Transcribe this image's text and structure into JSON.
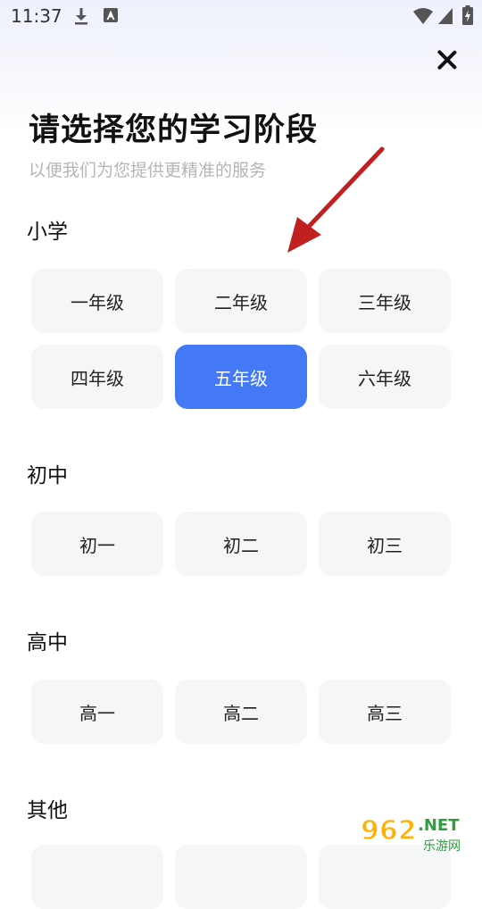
{
  "status_bar": {
    "time": "11:37"
  },
  "header": {
    "title": "请选择您的学习阶段",
    "subtitle": "以便我们为您提供更精准的服务"
  },
  "sections": [
    {
      "label": "小学",
      "options": [
        "一年级",
        "二年级",
        "三年级",
        "四年级",
        "五年级",
        "六年级"
      ],
      "selected": "五年级"
    },
    {
      "label": "初中",
      "options": [
        "初一",
        "初二",
        "初三"
      ]
    },
    {
      "label": "高中",
      "options": [
        "高一",
        "高二",
        "高三"
      ]
    },
    {
      "label": "其他"
    }
  ],
  "watermark": {
    "number": "962",
    "suffix": ".NET",
    "sub": "乐游网"
  },
  "colors": {
    "accent": "#4479f6",
    "option_bg": "#f5f6f8",
    "annotation_arrow": "#c0201f"
  }
}
